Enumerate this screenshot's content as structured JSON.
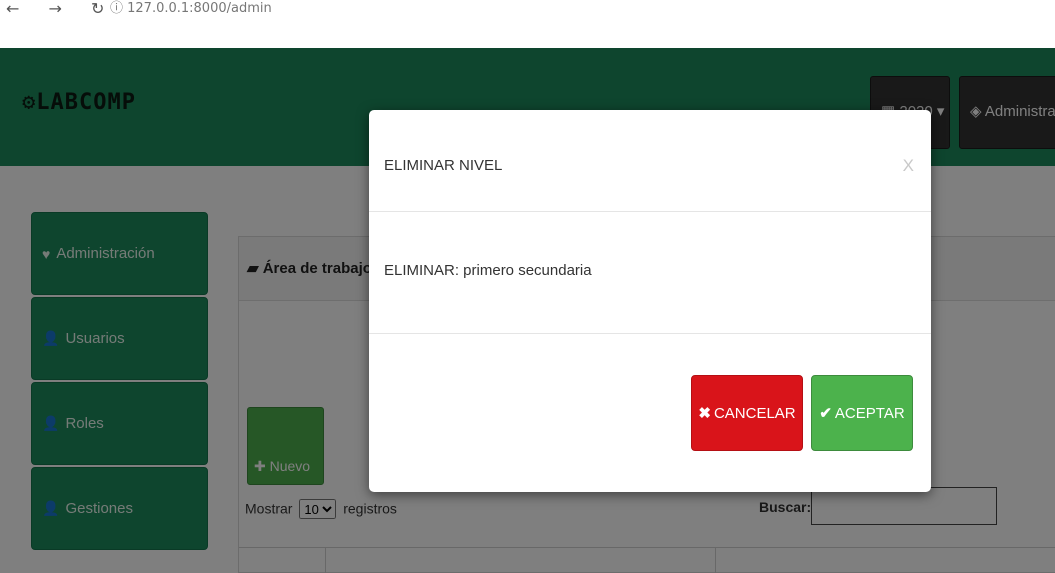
{
  "browser": {
    "nav_symbols": "← → ↻",
    "url": "ⓘ 127.0.0.1:8000/admin"
  },
  "header": {
    "logo": "LABCOMP",
    "logo_icon": "gear-icon",
    "year_label": "2020",
    "admin_label": "Administrador"
  },
  "sidebar": {
    "items": [
      {
        "label": "Administración",
        "icon": "heart-icon"
      },
      {
        "label": "Usuarios",
        "icon": "user-icon"
      },
      {
        "label": "Roles",
        "icon": "user-icon"
      },
      {
        "label": "Gestiones",
        "icon": "user-icon"
      }
    ]
  },
  "panel": {
    "title": "Área de trabajo",
    "new_button": "Nuevo",
    "show_prefix": "Mostrar",
    "page_size": "10",
    "show_suffix": "registros",
    "search_label": "Buscar:"
  },
  "modal": {
    "title": "ELIMINAR NIVEL",
    "close": "X",
    "message": "ELIMINAR: primero secundaria",
    "cancel_label": "CANCELAR",
    "accept_label": "ACEPTAR"
  },
  "colors": {
    "brand": "#1c8a5d",
    "danger": "#d9141a",
    "success": "#4cb24c"
  }
}
